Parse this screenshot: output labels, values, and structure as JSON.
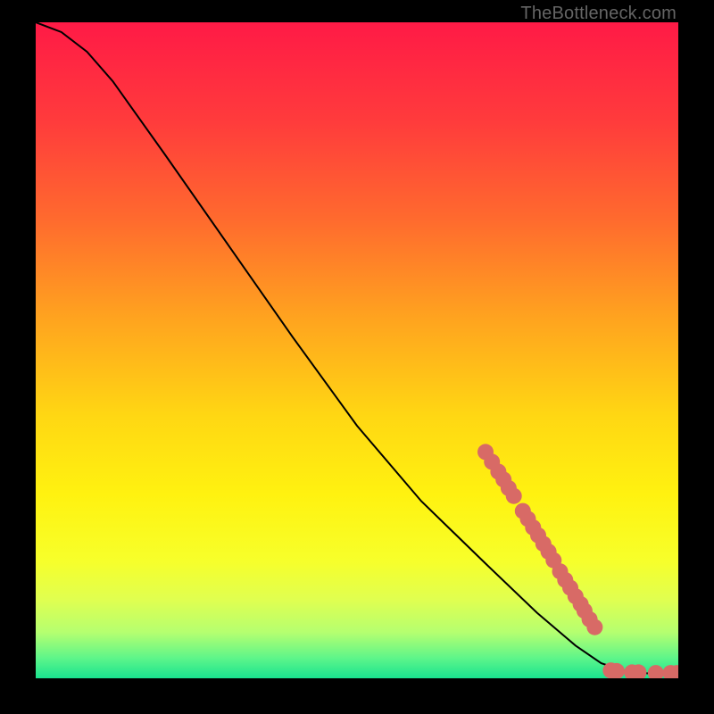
{
  "attribution": "TheBottleneck.com",
  "chart_data": {
    "type": "line",
    "title": "",
    "xlabel": "",
    "ylabel": "",
    "xlim": [
      0,
      100
    ],
    "ylim": [
      0,
      100
    ],
    "background_gradient": {
      "stops": [
        {
          "offset": 0.0,
          "color": "#ff1a46"
        },
        {
          "offset": 0.15,
          "color": "#ff3b3c"
        },
        {
          "offset": 0.3,
          "color": "#ff6a2e"
        },
        {
          "offset": 0.45,
          "color": "#ffa31f"
        },
        {
          "offset": 0.6,
          "color": "#ffd713"
        },
        {
          "offset": 0.72,
          "color": "#fff210"
        },
        {
          "offset": 0.82,
          "color": "#f7ff2a"
        },
        {
          "offset": 0.88,
          "color": "#e0ff50"
        },
        {
          "offset": 0.93,
          "color": "#b5ff70"
        },
        {
          "offset": 0.97,
          "color": "#5cf58a"
        },
        {
          "offset": 1.0,
          "color": "#19e38f"
        }
      ]
    },
    "series": [
      {
        "name": "curve",
        "style": "line",
        "color": "#000000",
        "points": [
          {
            "x": 0.0,
            "y": 100.0
          },
          {
            "x": 4.0,
            "y": 98.5
          },
          {
            "x": 8.0,
            "y": 95.5
          },
          {
            "x": 12.0,
            "y": 91.0
          },
          {
            "x": 16.0,
            "y": 85.5
          },
          {
            "x": 20.0,
            "y": 80.0
          },
          {
            "x": 30.0,
            "y": 66.0
          },
          {
            "x": 40.0,
            "y": 52.0
          },
          {
            "x": 50.0,
            "y": 38.5
          },
          {
            "x": 60.0,
            "y": 27.0
          },
          {
            "x": 70.0,
            "y": 17.5
          },
          {
            "x": 78.0,
            "y": 10.0
          },
          {
            "x": 84.0,
            "y": 5.0
          },
          {
            "x": 88.0,
            "y": 2.3
          },
          {
            "x": 92.0,
            "y": 1.0
          },
          {
            "x": 96.0,
            "y": 0.7
          },
          {
            "x": 100.0,
            "y": 0.7
          }
        ]
      },
      {
        "name": "markers",
        "style": "scatter",
        "color": "#d86a66",
        "radius_px": 9,
        "points": [
          {
            "x": 70.0,
            "y": 34.5
          },
          {
            "x": 71.0,
            "y": 33.0
          },
          {
            "x": 72.0,
            "y": 31.5
          },
          {
            "x": 72.8,
            "y": 30.3
          },
          {
            "x": 73.6,
            "y": 29.0
          },
          {
            "x": 74.4,
            "y": 27.8
          },
          {
            "x": 75.8,
            "y": 25.5
          },
          {
            "x": 76.6,
            "y": 24.3
          },
          {
            "x": 77.4,
            "y": 23.0
          },
          {
            "x": 78.2,
            "y": 21.8
          },
          {
            "x": 79.0,
            "y": 20.5
          },
          {
            "x": 79.8,
            "y": 19.3
          },
          {
            "x": 80.6,
            "y": 18.0
          },
          {
            "x": 81.6,
            "y": 16.3
          },
          {
            "x": 82.4,
            "y": 15.0
          },
          {
            "x": 83.2,
            "y": 13.8
          },
          {
            "x": 84.0,
            "y": 12.5
          },
          {
            "x": 84.8,
            "y": 11.3
          },
          {
            "x": 85.4,
            "y": 10.3
          },
          {
            "x": 86.2,
            "y": 9.0
          },
          {
            "x": 87.0,
            "y": 7.8
          },
          {
            "x": 89.5,
            "y": 1.2
          },
          {
            "x": 90.4,
            "y": 1.1
          },
          {
            "x": 92.8,
            "y": 0.9
          },
          {
            "x": 93.8,
            "y": 0.9
          },
          {
            "x": 96.5,
            "y": 0.8
          },
          {
            "x": 98.8,
            "y": 0.8
          },
          {
            "x": 99.8,
            "y": 0.8
          }
        ]
      }
    ]
  }
}
